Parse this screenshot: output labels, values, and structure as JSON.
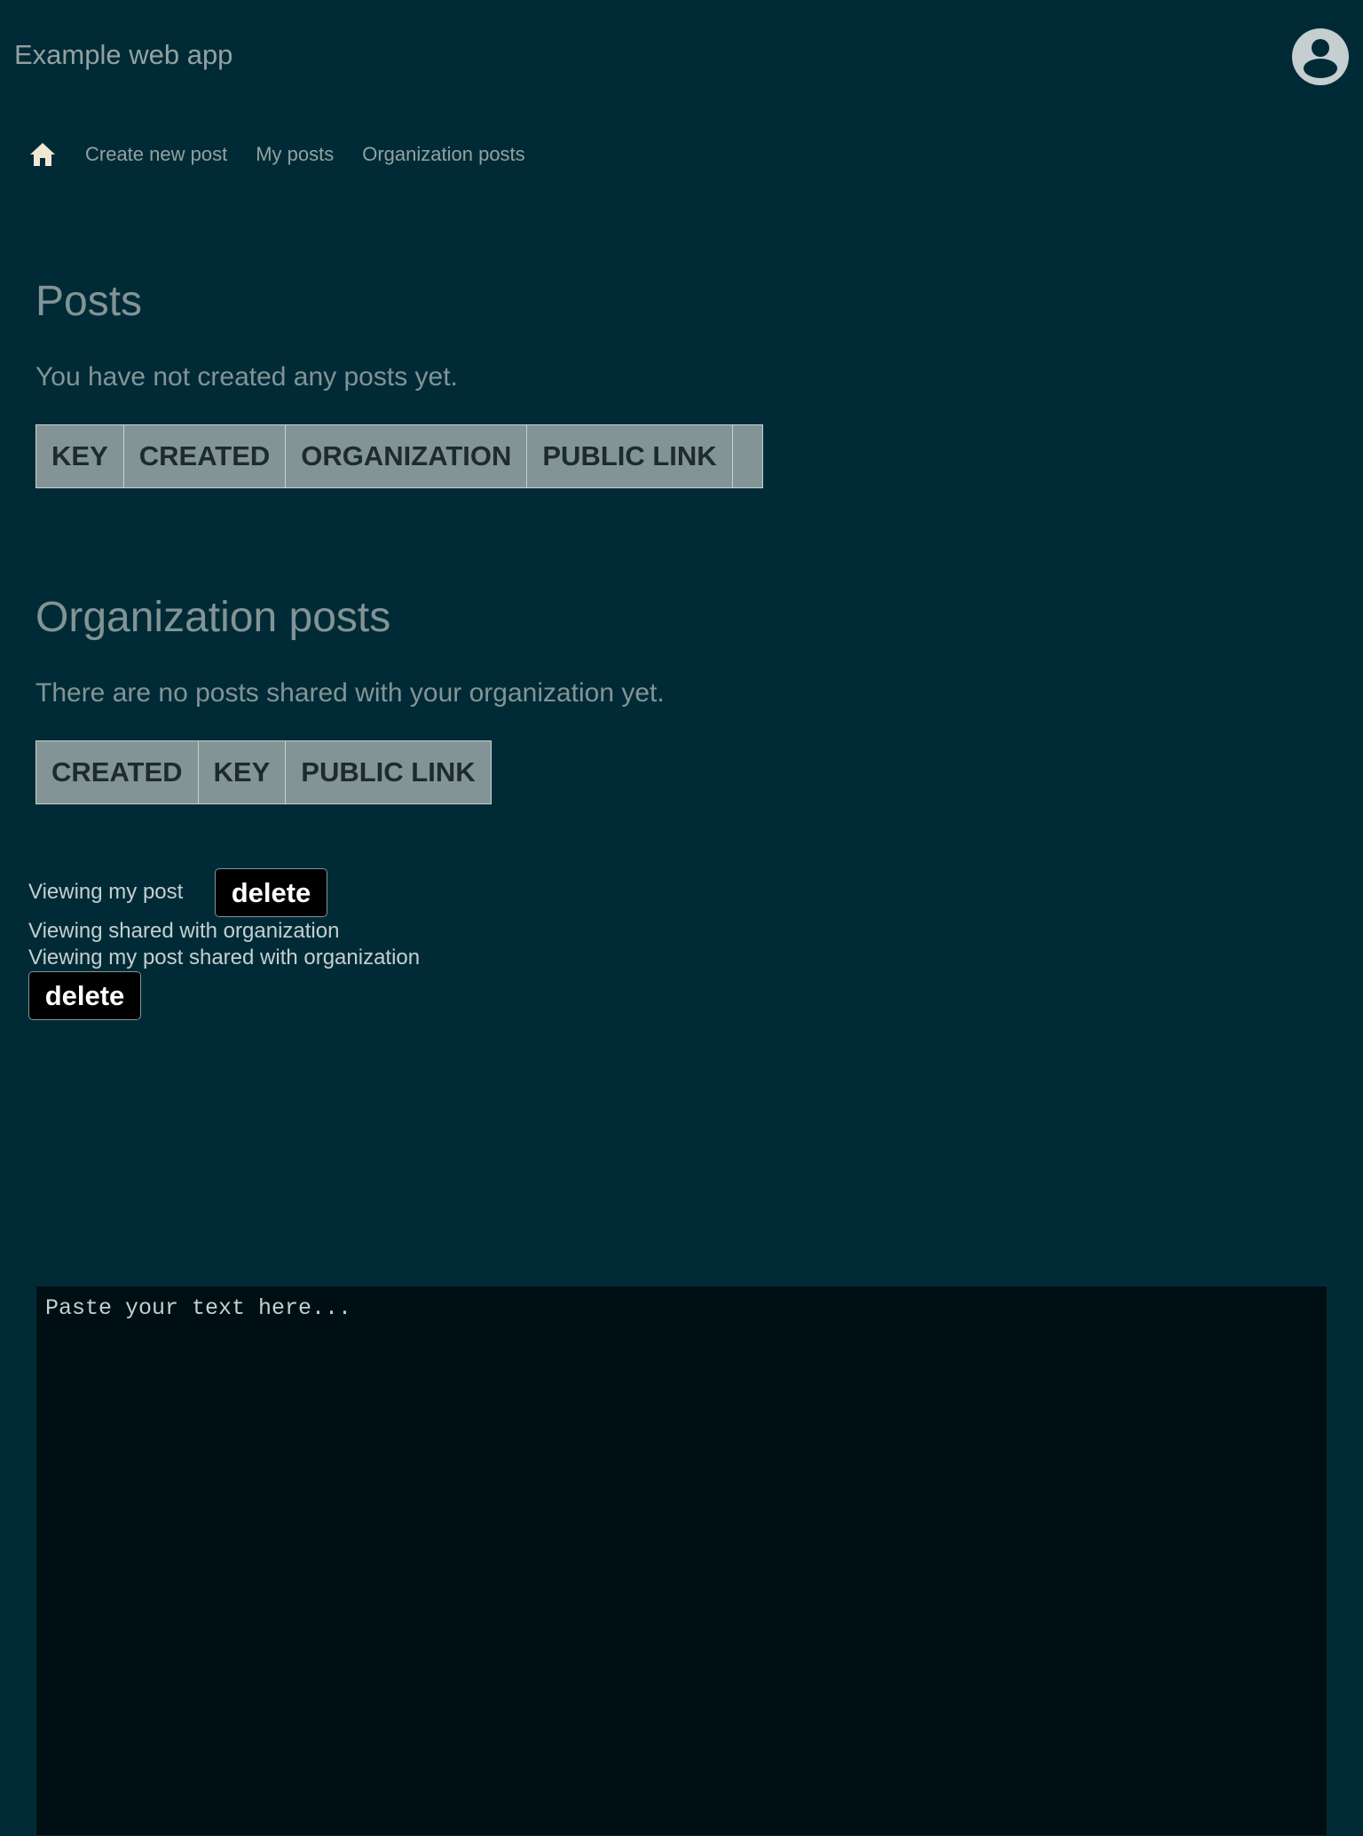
{
  "header": {
    "app_title": "Example web app",
    "avatar_icon": "user-circle-icon"
  },
  "nav": {
    "home_icon": "home-icon",
    "links": [
      "Create new post",
      "My posts",
      "Organization posts"
    ]
  },
  "posts": {
    "title": "Posts",
    "empty_message": "You have not created any posts yet.",
    "columns": [
      "KEY",
      "CREATED",
      "ORGANIZATION",
      "PUBLIC LINK",
      ""
    ]
  },
  "org_posts": {
    "title": "Organization posts",
    "empty_message": "There are no posts shared with your organization yet.",
    "columns": [
      "CREATED",
      "KEY",
      "PUBLIC LINK"
    ]
  },
  "viewing": {
    "my_post": "Viewing my post",
    "shared_with_org": "Viewing shared with organization",
    "my_post_shared": "Viewing my post shared with organization",
    "delete_label": "delete"
  },
  "editor": {
    "placeholder": "Paste your text here..."
  },
  "colors": {
    "background": "#002b36",
    "text": "#839496",
    "table_header_bg": "#839496",
    "button_bg": "#000000",
    "editor_bg": "#000f14"
  }
}
